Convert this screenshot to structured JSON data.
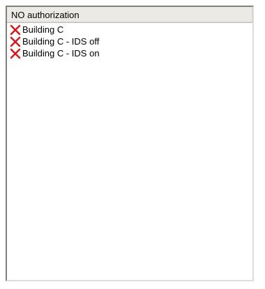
{
  "list": {
    "column_header": "NO authorization",
    "items": [
      {
        "label": "Building C",
        "icon": "red-x-icon"
      },
      {
        "label": "Building C - IDS off",
        "icon": "red-x-icon"
      },
      {
        "label": "Building C - IDS on",
        "icon": "red-x-icon"
      }
    ]
  },
  "colors": {
    "icon_red": "#d3191e",
    "header_bg": "#ebeae4"
  }
}
